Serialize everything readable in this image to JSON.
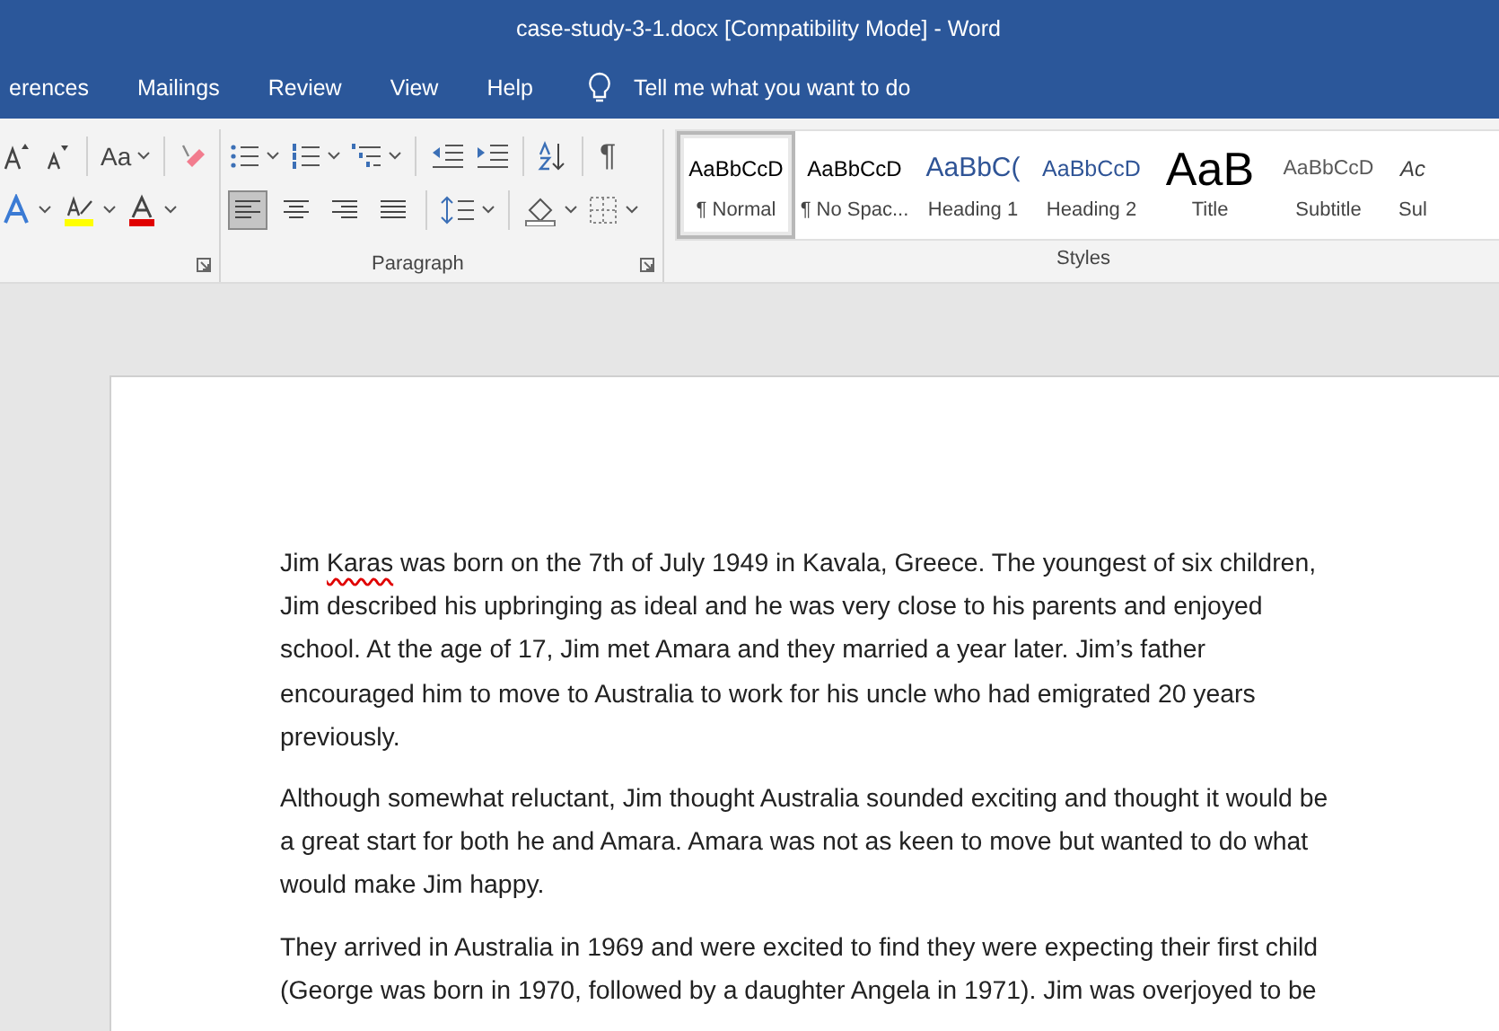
{
  "window": {
    "title": "case-study-3-1.docx [Compatibility Mode]  -  Word"
  },
  "tabs": [
    {
      "label": "erences",
      "selected": false
    },
    {
      "label": "Mailings",
      "selected": false
    },
    {
      "label": "Review",
      "selected": false
    },
    {
      "label": "View",
      "selected": false
    },
    {
      "label": "Help",
      "selected": false
    }
  ],
  "tell_me": {
    "placeholder": "Tell me what you want to do"
  },
  "font_group": {
    "change_case": "Aa"
  },
  "paragraph_group": {
    "label": "Paragraph",
    "show_marks": "¶",
    "alignment": [
      {
        "selected": true
      },
      {
        "selected": false
      },
      {
        "selected": false
      },
      {
        "selected": false
      }
    ]
  },
  "styles_group": {
    "label": "Styles",
    "styles": [
      {
        "preview": "AaBbCcD",
        "name": "¶ Normal",
        "kind": "normal",
        "selected": true
      },
      {
        "preview": "AaBbCcD",
        "name": "¶ No Spac...",
        "kind": "normal",
        "selected": false
      },
      {
        "preview": "AaBbC(",
        "name": "Heading 1",
        "kind": "heading1",
        "selected": false
      },
      {
        "preview": "AaBbCcD",
        "name": "Heading 2",
        "kind": "heading2",
        "selected": false
      },
      {
        "preview": "AaB",
        "name": "Title",
        "kind": "title",
        "selected": false
      },
      {
        "preview": "AaBbCcD",
        "name": "Subtitle",
        "kind": "subtitle",
        "selected": false
      },
      {
        "preview": "Ac",
        "name": "Sul",
        "kind": "subtle",
        "selected": false
      }
    ]
  },
  "document": {
    "paragraphs": [
      [
        {
          "text": "Jim "
        },
        {
          "text": "Karas",
          "misspelled": true
        },
        {
          "text": " was born on the 7th of July 1949 in Kavala, Greece. The youngest of six children, Jim described his upbringing as ideal and he was very close to his parents and enjoyed school. At the age of 17, Jim met Amara and they married a year later. Jim’s father encouraged him to move to Australia to work for his uncle who had emigrated 20 years previously."
        }
      ],
      [
        {
          "text": "Although somewhat reluctant, Jim thought Australia sounded exciting and thought it would be a great start for both he and Amara. Amara was not as keen to move but wanted to do what would make Jim happy."
        }
      ],
      [
        {
          "text": "They arrived in Australia in 1969 and were excited to find they were expecting their first child (George was born in 1970, followed by a daughter Angela in 1971). Jim was overjoyed to be"
        }
      ]
    ]
  }
}
